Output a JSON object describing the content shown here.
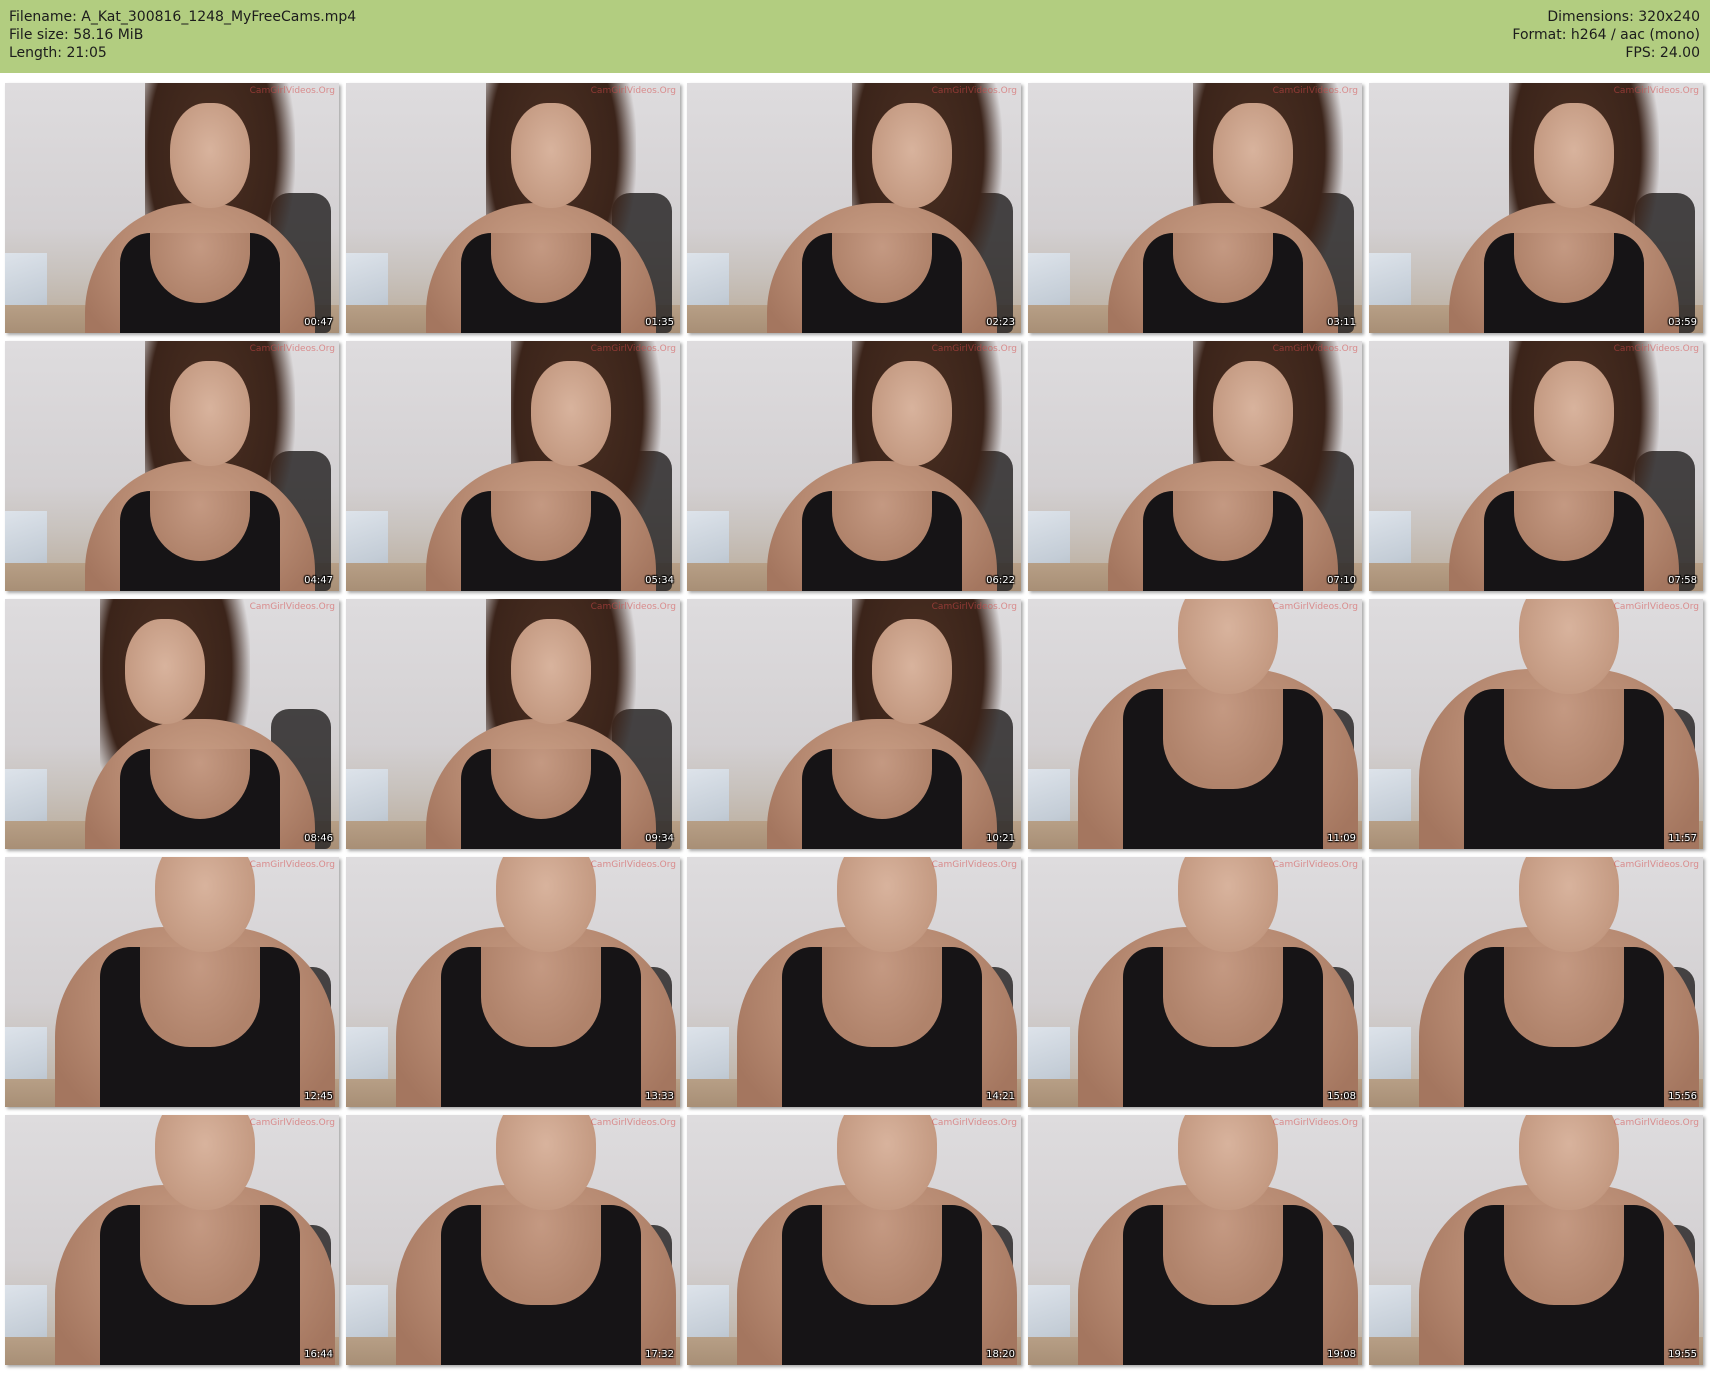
{
  "header": {
    "filename": "Filename: A_Kat_300816_1248_MyFreeCams.mp4",
    "filesize": "File size: 58.16 MiB",
    "length": "Length: 21:05",
    "dimensions": "Dimensions: 320x240",
    "format": "Format: h264 / aac (mono)",
    "fps": "FPS: 24.00"
  },
  "thumbnails": [
    {
      "time": "00:47"
    },
    {
      "time": "01:35"
    },
    {
      "time": "02:23"
    },
    {
      "time": "03:11"
    },
    {
      "time": "03:59"
    },
    {
      "time": "04:47"
    },
    {
      "time": "05:34"
    },
    {
      "time": "06:22"
    },
    {
      "time": "07:10"
    },
    {
      "time": "07:58"
    },
    {
      "time": "08:46"
    },
    {
      "time": "09:34"
    },
    {
      "time": "10:21"
    },
    {
      "time": "11:09"
    },
    {
      "time": "11:57"
    },
    {
      "time": "12:45"
    },
    {
      "time": "13:33"
    },
    {
      "time": "14:21"
    },
    {
      "time": "15:08"
    },
    {
      "time": "15:56"
    },
    {
      "time": "16:44"
    },
    {
      "time": "17:32"
    },
    {
      "time": "18:20"
    },
    {
      "time": "19:08"
    },
    {
      "time": "19:55"
    }
  ],
  "watermark_text": "CamGirlVideos.Org",
  "colors": {
    "header_bg": "#b2cd80",
    "timestamp": "#ffffff"
  }
}
